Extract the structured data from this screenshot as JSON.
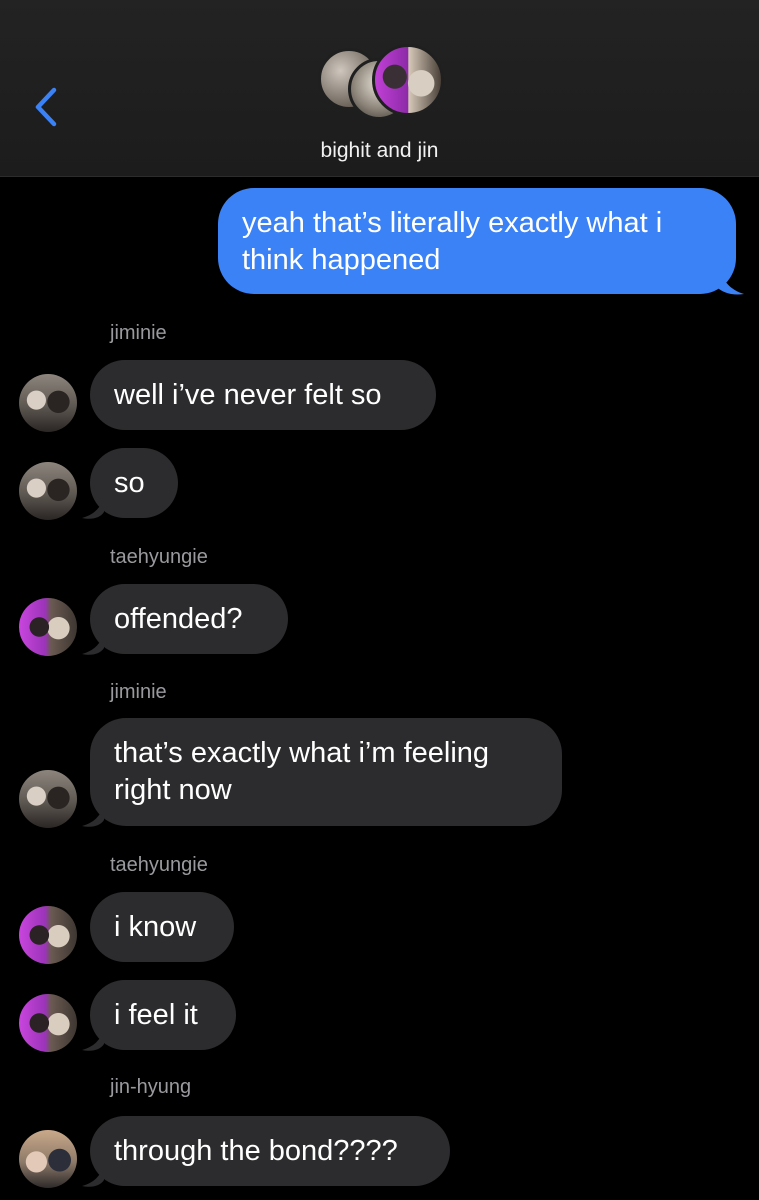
{
  "header": {
    "conversation_name": "bighit and jin",
    "back_icon": "chevron-left-icon",
    "accent_color": "#3b82f6"
  },
  "messages": [
    {
      "type": "sent",
      "lines": [
        "yeah that’s literally exactly what i",
        "think happened"
      ]
    },
    {
      "type": "sender",
      "name": "jiminie"
    },
    {
      "type": "received",
      "avatar": "jimin",
      "lines": [
        "well i’ve never felt so"
      ]
    },
    {
      "type": "received",
      "avatar": "jimin",
      "lines": [
        "so"
      ]
    },
    {
      "type": "sender",
      "name": "taehyungie"
    },
    {
      "type": "received",
      "avatar": "tae",
      "lines": [
        "offended?"
      ]
    },
    {
      "type": "sender",
      "name": "jiminie"
    },
    {
      "type": "received",
      "avatar": "jimin",
      "lines": [
        "that’s exactly what i’m feeling",
        "right now"
      ]
    },
    {
      "type": "sender",
      "name": "taehyungie"
    },
    {
      "type": "received",
      "avatar": "tae",
      "lines": [
        "i know"
      ]
    },
    {
      "type": "received",
      "avatar": "tae",
      "lines": [
        "i feel it"
      ]
    },
    {
      "type": "sender",
      "name": "jin-hyung"
    },
    {
      "type": "received",
      "avatar": "jin",
      "lines": [
        "through the bond????"
      ]
    }
  ],
  "colors": {
    "background": "#000000",
    "sent_bubble": "#3b82f6",
    "received_bubble": "#2c2c2e",
    "sender_name": "#9a9a9e"
  }
}
